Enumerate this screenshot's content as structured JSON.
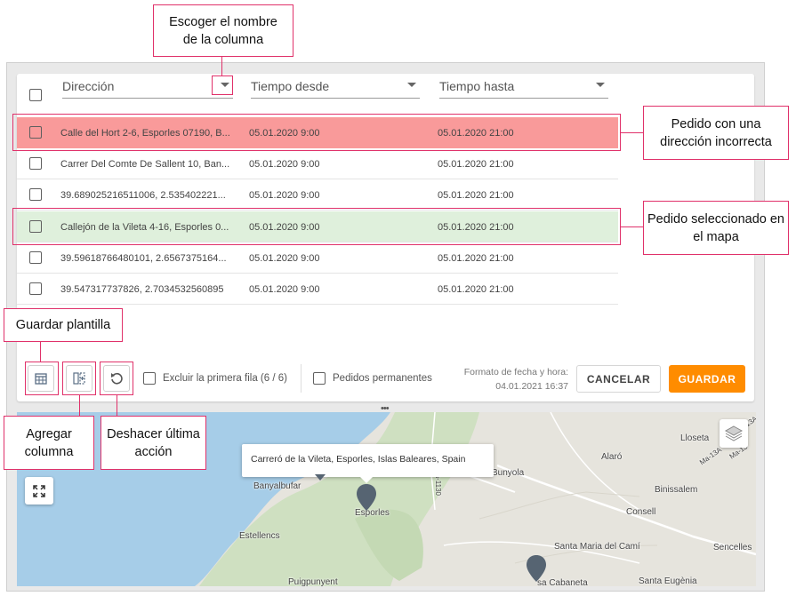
{
  "annotations": {
    "choose_column": "Escoger el nombre de la columna",
    "wrong_address": "Pedido con una dirección incorrecta",
    "selected_on_map": "Pedido seleccionado en el mapa",
    "save_template": "Guardar plantilla",
    "add_column": "Agregar columna",
    "undo_last": "Deshacer última acción"
  },
  "table": {
    "columns": [
      "Dirección",
      "Tiempo desde",
      "Tiempo hasta"
    ],
    "rows": [
      {
        "address": "Calle del Hort 2-6, Esporles 07190, B...",
        "from": "05.01.2020 9:00",
        "to": "05.01.2020 21:00",
        "state": "error"
      },
      {
        "address": "Carrer Del Comte De Sallent 10, Ban...",
        "from": "05.01.2020 9:00",
        "to": "05.01.2020 21:00",
        "state": "normal"
      },
      {
        "address": "39.689025216511006, 2.535402221...",
        "from": "05.01.2020 9:00",
        "to": "05.01.2020 21:00",
        "state": "normal"
      },
      {
        "address": "Callejón de la Vileta 4-16, Esporles 0...",
        "from": "05.01.2020 9:00",
        "to": "05.01.2020 21:00",
        "state": "selected"
      },
      {
        "address": "39.59618766480101, 2.6567375164...",
        "from": "05.01.2020 9:00",
        "to": "05.01.2020 21:00",
        "state": "normal"
      },
      {
        "address": "39.547317737826, 2.7034532560895",
        "from": "05.01.2020 9:00",
        "to": "05.01.2020 21:00",
        "state": "normal"
      }
    ]
  },
  "toolbar": {
    "exclude_first_row": "Excluir la primera fila (6 / 6)",
    "permanent_orders": "Pedidos permanentes",
    "date_format_label": "Formato de fecha y hora:",
    "date_format_value": "04.01.2021 16:37",
    "cancel": "CANCELAR",
    "save": "GUARDAR",
    "icons": [
      "save-template-icon",
      "add-column-icon",
      "undo-icon"
    ]
  },
  "map": {
    "popup": "Carreró de la Vileta, Esporles, Islas Baleares, Spain",
    "places": [
      "Banyalbufar",
      "Esporles",
      "Estellencs",
      "Puigpunyent",
      "Bunyola",
      "Alaró",
      "Binissalem",
      "Consell",
      "Santa Maria del Camí",
      "Sencelles",
      "Santa Eugènia",
      "sa Cabaneta",
      "Lloseta",
      "Ma-13A",
      "Ma-13",
      "Ma-13A"
    ],
    "road_label": "Ma-1130"
  },
  "colors": {
    "error_row": "#f99a9a",
    "selected_row": "#dff0dc",
    "accent": "#ff8c00",
    "annotation_border": "#e0316a"
  }
}
